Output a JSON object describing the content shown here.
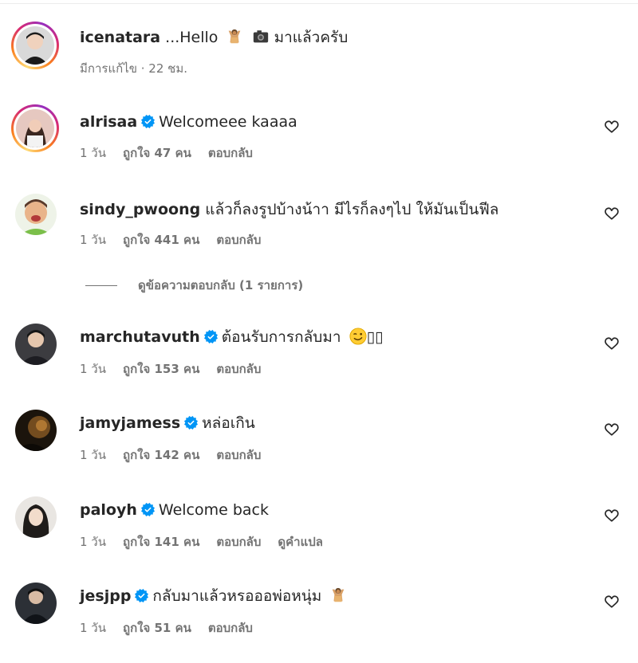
{
  "caption": {
    "username": "icenatara",
    "text_prefix": "...Hello",
    "text_suffix": "มาแล้วครับ",
    "meta": "มีการแก้ไข · 22 ชม."
  },
  "comments": [
    {
      "username": "alrisaa",
      "verified": true,
      "text": "Welcomeee kaaaa",
      "time": "1 วัน",
      "likes": "ถูกใจ 47 คน",
      "reply": "ตอบกลับ"
    },
    {
      "username": "sindy_pwoong",
      "verified": false,
      "text": "แล้วก็ลงรูปบ้างน้าา มีไรก็ลงๆไป ให้มันเป็นฟีล",
      "time": "1 วัน",
      "likes": "ถูกใจ 441 คน",
      "reply": "ตอบกลับ"
    },
    {
      "username": "marchutavuth",
      "verified": true,
      "text": "ต้อนรับการกลับมา",
      "text_after_emoji": "▯▯",
      "time": "1 วัน",
      "likes": "ถูกใจ 153 คน",
      "reply": "ตอบกลับ"
    },
    {
      "username": "jamyjamess",
      "verified": true,
      "text": "หล่อเกิน",
      "time": "1 วัน",
      "likes": "ถูกใจ 142 คน",
      "reply": "ตอบกลับ"
    },
    {
      "username": "paloyh",
      "verified": true,
      "text": "Welcome back",
      "time": "1 วัน",
      "likes": "ถูกใจ 141 คน",
      "reply": "ตอบกลับ",
      "translate": "ดูคำแปล"
    },
    {
      "username": "jesjpp",
      "verified": true,
      "text": "กลับมาแล้วหรอออพ่อหนุ่ม",
      "time": "1 วัน",
      "likes": "ถูกใจ 51 คน",
      "reply": "ตอบกลับ"
    }
  ],
  "view_replies": "ดูข้อความตอบกลับ (1 รายการ)",
  "icons": {
    "heart": "heart-outline-icon",
    "verified": "verified-badge-icon",
    "person_raising_hands": "raising-hands-emoji",
    "camera": "camera-emoji",
    "wink": "wink-emoji"
  },
  "colors": {
    "verified": "#0095f6",
    "muted": "#737373",
    "text": "#262626"
  }
}
